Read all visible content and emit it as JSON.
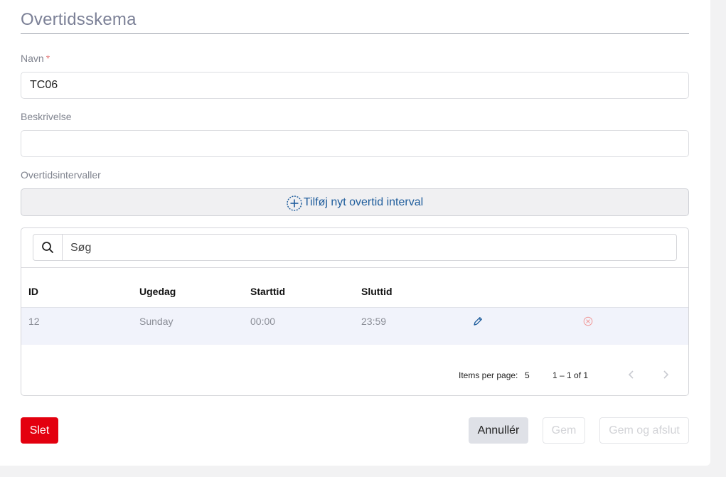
{
  "form": {
    "title": "Overtidsskema",
    "name_label": "Navn",
    "required_mark": "*",
    "name_value": "TC06",
    "description_label": "Beskrivelse",
    "description_value": "",
    "intervals_label": "Overtidsintervaller",
    "add_interval_label": "Tilføj nyt overtid interval"
  },
  "table": {
    "search_placeholder": "Søg",
    "columns": [
      "ID",
      "Ugedag",
      "Starttid",
      "Sluttid"
    ],
    "rows": [
      {
        "id": "12",
        "weekday": "Sunday",
        "start": "00:00",
        "end": "23:59"
      }
    ],
    "paginator": {
      "items_per_page_label": "Items per page:",
      "items_per_page_value": "5",
      "range_label": "1 – 1 of 1"
    }
  },
  "actions": {
    "delete_label": "Slet",
    "cancel_label": "Annullér",
    "save_label": "Gem",
    "save_close_label": "Gem og afslut"
  },
  "colors": {
    "accent": "#1f5d9c",
    "delete": "#e3000f",
    "title": "#7c8197"
  },
  "icons": {
    "add": "plus-circle-icon",
    "search": "search-icon",
    "edit": "pencil-icon",
    "remove": "circle-x-icon",
    "prev": "chevron-left-icon",
    "next": "chevron-right-icon"
  }
}
